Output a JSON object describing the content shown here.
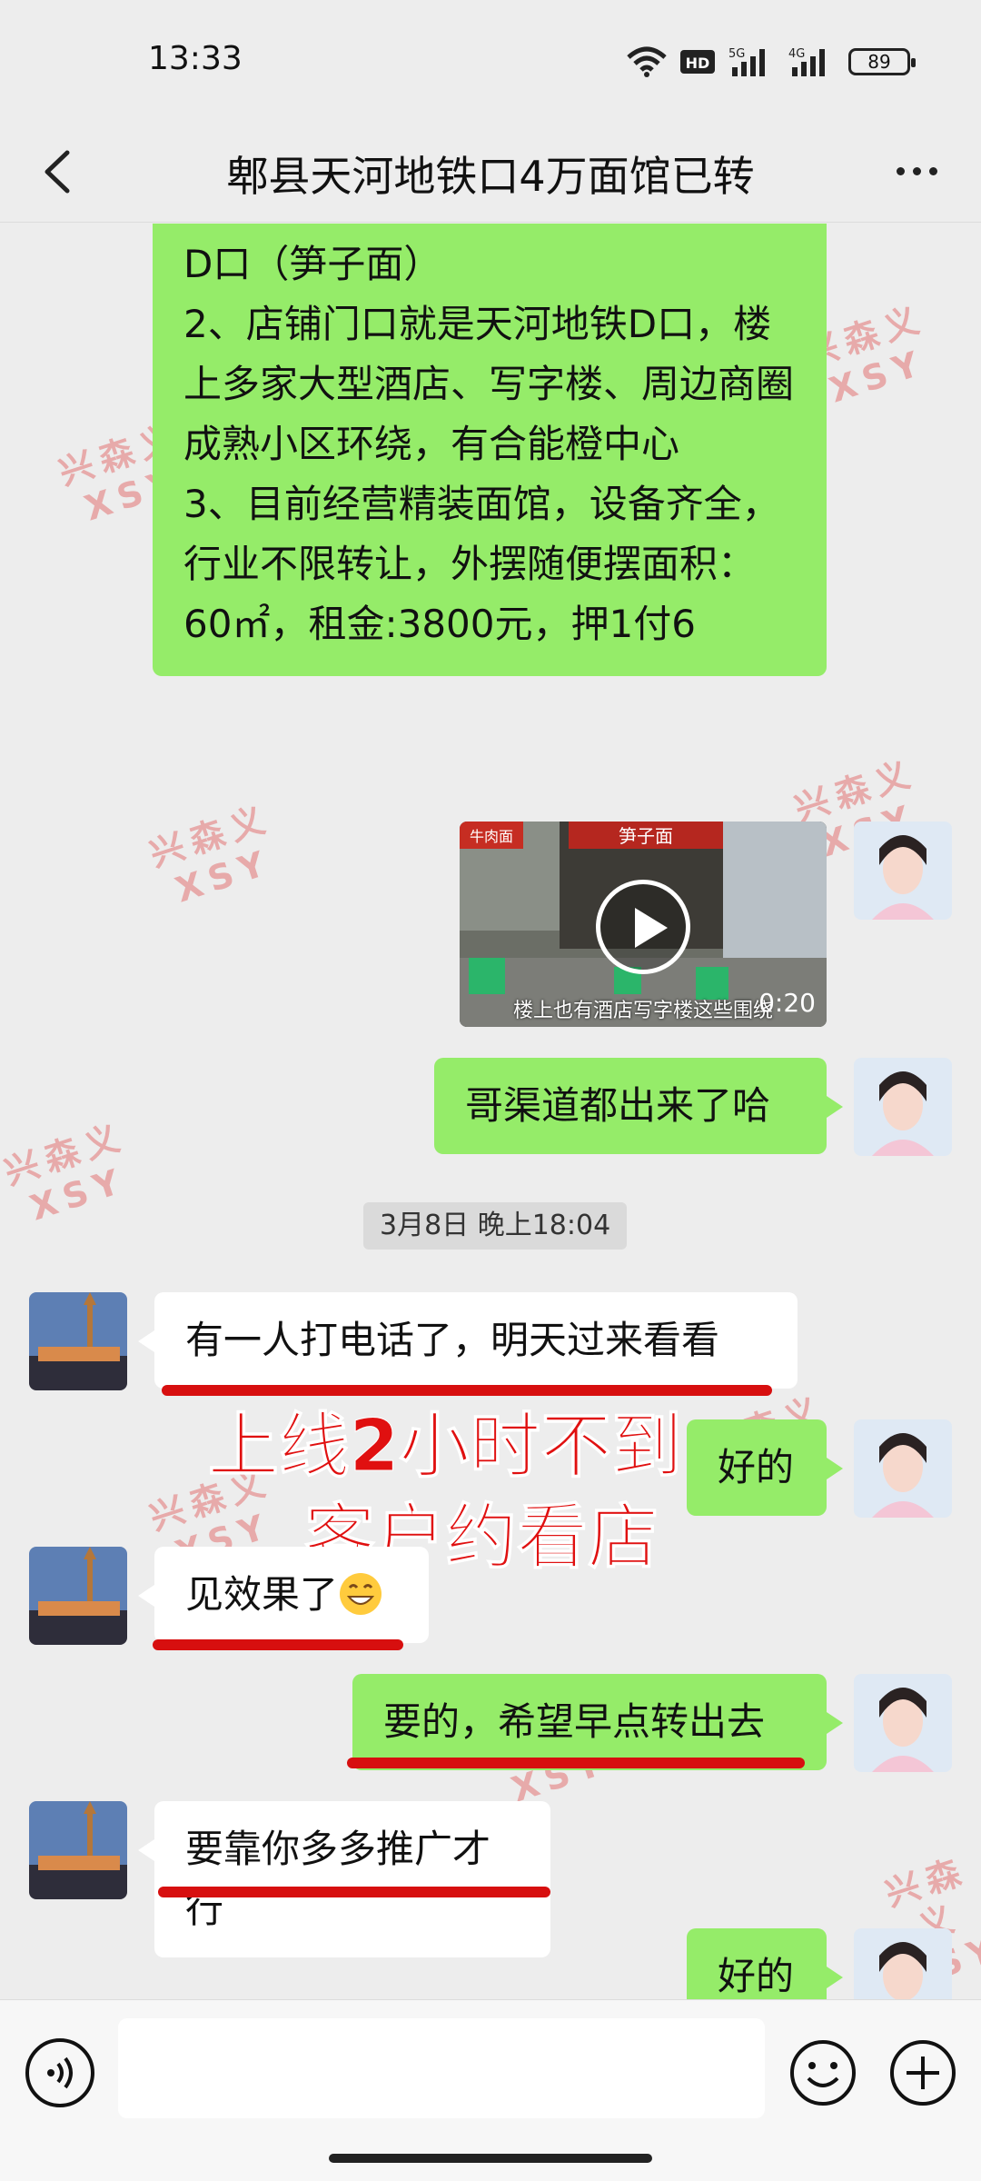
{
  "status_bar": {
    "time": "13:33",
    "network": [
      "5G",
      "4G"
    ],
    "hd_label": "HD",
    "battery": "89"
  },
  "nav": {
    "back_icon": "chevron-left-icon",
    "title": "郫县天河地铁口4万面馆已转",
    "more_icon": "more-dots-icon"
  },
  "messages": {
    "listing": "D口（笋子面）\n2、店铺门口就是天河地铁D口，楼上多家大型酒店、写字楼、周边商圈成熟小区环绕，有合能橙中心\n3、目前经营精装面馆，设备齐全，行业不限转让，外摆随便摆面积：60㎡，租金:3800元，押1付6",
    "video": {
      "shop_sign": "笋子面",
      "side_sign": "牛肉面",
      "duration": "0:20",
      "caption": "楼上也有酒店写字楼这些围绕"
    },
    "m1": "哥渠道都出来了哈",
    "timestamp": "3月8日 晚上18:04",
    "m2": "有一人打电话了，明天过来看看",
    "m3": "好的",
    "m4": "见效果了",
    "m5": "要的，希望早点转出去",
    "m6": "要靠你多多推广才行",
    "m7": "好的"
  },
  "overlay": {
    "line1": "上线2小时不到",
    "line2": "客户约看店"
  },
  "watermark": {
    "line1": "兴森义",
    "line2": "XSY"
  },
  "colors": {
    "my_bubble": "#95ec69",
    "other_bubble": "#ffffff",
    "highlight_red": "#d70f0f",
    "background": "#ededed"
  },
  "input_bar": {
    "voice_icon": "voice-icon",
    "emoji_icon": "emoji-icon",
    "plus_icon": "plus-icon"
  }
}
